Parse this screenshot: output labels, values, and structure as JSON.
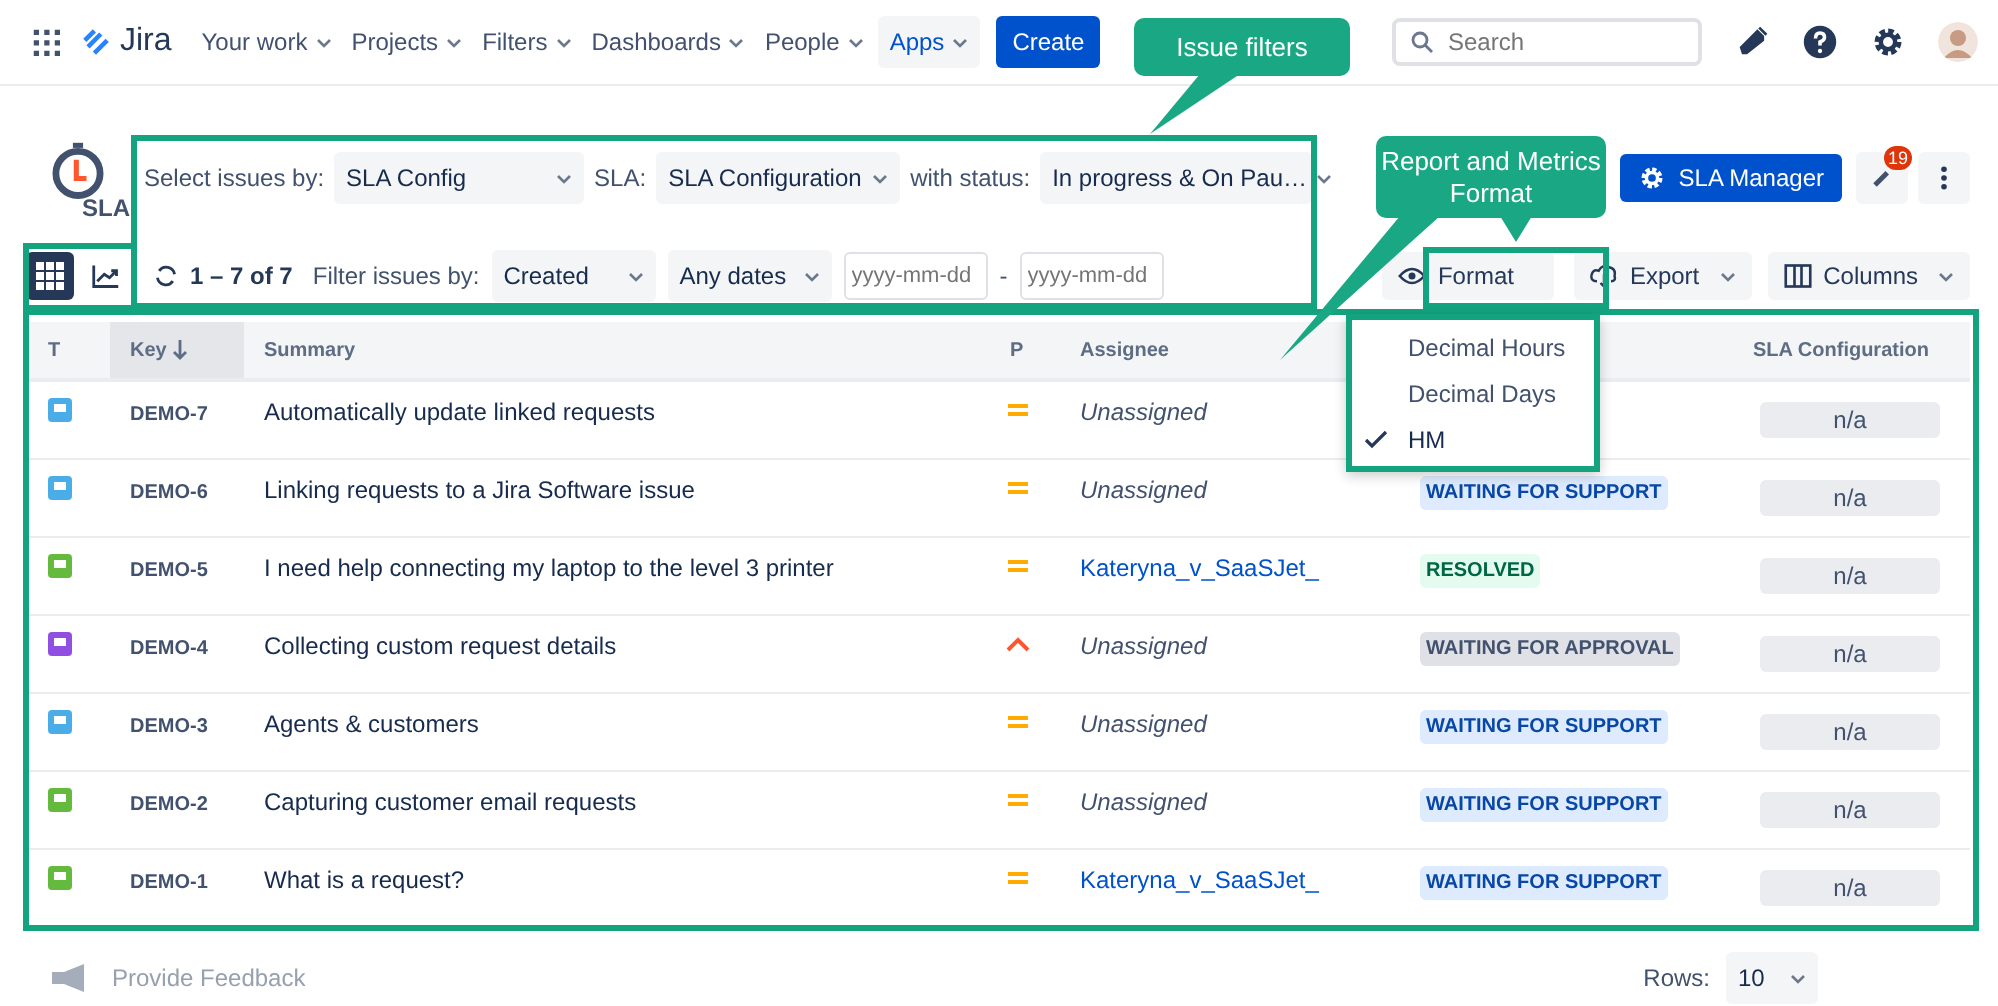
{
  "nav": {
    "product": "Jira",
    "items": [
      {
        "label": "Your work",
        "selected": false
      },
      {
        "label": "Projects",
        "selected": false
      },
      {
        "label": "Filters",
        "selected": false
      },
      {
        "label": "Dashboards",
        "selected": false
      },
      {
        "label": "People",
        "selected": false
      },
      {
        "label": "Apps",
        "selected": true
      }
    ],
    "create": "Create",
    "search": {
      "placeholder": "Search"
    }
  },
  "sla_bar": {
    "logo_text": "SLA",
    "select_label": "Select issues by:",
    "select_value": "SLA Config",
    "sla_label": "SLA:",
    "sla_value": "SLA Configuration",
    "status_label": "with status:",
    "status_value": "In progress & On Pau…",
    "manager_button": "SLA Manager",
    "notification_count": "19"
  },
  "toolbar": {
    "views": [
      {
        "kind": "table",
        "selected": true
      },
      {
        "kind": "chart",
        "selected": false
      }
    ],
    "count": "1 – 7 of 7",
    "filter_label": "Filter issues by:",
    "filter_value": "Created",
    "date_range": "Any dates",
    "date_from": {
      "placeholder": "yyyy-mm-dd"
    },
    "separator": "-",
    "date_to": {
      "placeholder": "yyyy-mm-dd"
    },
    "format": "Format",
    "export": "Export",
    "columns": "Columns"
  },
  "format_menu": [
    {
      "label": "Decimal Hours",
      "checked": false
    },
    {
      "label": "Decimal Days",
      "checked": false
    },
    {
      "label": "HM",
      "checked": true
    }
  ],
  "table": {
    "columns": [
      {
        "label": "T",
        "sorted": false
      },
      {
        "label": "Key",
        "sorted": true
      },
      {
        "label": "Summary",
        "sorted": false
      },
      {
        "label": "P",
        "sorted": false
      },
      {
        "label": "Assignee",
        "sorted": false
      },
      {
        "label": "SLA Configuration",
        "sorted": false
      }
    ],
    "rows": [
      {
        "type": {
          "kind": "service"
        },
        "key": "DEMO-7",
        "summary": "Automatically update linked requests",
        "priority": {
          "kind": "medium"
        },
        "assignee": "Unassigned",
        "assigned": false,
        "sla": "n/a"
      },
      {
        "type": {
          "kind": "service"
        },
        "key": "DEMO-6",
        "summary": "Linking requests to a Jira Software issue",
        "priority": {
          "kind": "medium"
        },
        "assignee": "Unassigned",
        "assigned": false,
        "status": {
          "text": "WAITING FOR SUPPORT",
          "kind": "progress"
        },
        "sla": "n/a"
      },
      {
        "type": {
          "kind": "chat"
        },
        "key": "DEMO-5",
        "summary": "I need help connecting my laptop to the level 3 printer",
        "priority": {
          "kind": "medium"
        },
        "assignee": "Kateryna_v_SaaSJet_",
        "assigned": true,
        "status": {
          "text": "RESOLVED",
          "kind": "done"
        },
        "sla": "n/a"
      },
      {
        "type": {
          "kind": "form"
        },
        "key": "DEMO-4",
        "summary": "Collecting custom request details",
        "priority": {
          "kind": "high"
        },
        "assignee": "Unassigned",
        "assigned": false,
        "status": {
          "text": "WAITING FOR APPROVAL",
          "kind": "todo"
        },
        "sla": "n/a"
      },
      {
        "type": {
          "kind": "service"
        },
        "key": "DEMO-3",
        "summary": "Agents & customers",
        "priority": {
          "kind": "medium"
        },
        "assignee": "Unassigned",
        "assigned": false,
        "status": {
          "text": "WAITING FOR SUPPORT",
          "kind": "progress"
        },
        "sla": "n/a"
      },
      {
        "type": {
          "kind": "chat"
        },
        "key": "DEMO-2",
        "summary": "Capturing customer email requests",
        "priority": {
          "kind": "medium"
        },
        "assignee": "Unassigned",
        "assigned": false,
        "status": {
          "text": "WAITING FOR SUPPORT",
          "kind": "progress"
        },
        "sla": "n/a"
      },
      {
        "type": {
          "kind": "chat"
        },
        "key": "DEMO-1",
        "summary": "What is a request?",
        "priority": {
          "kind": "medium"
        },
        "assignee": "Kateryna_v_SaaSJet_",
        "assigned": true,
        "status": {
          "text": "WAITING FOR SUPPORT",
          "kind": "progress"
        },
        "sla": "n/a"
      }
    ]
  },
  "footer": {
    "feedback": "Provide Feedback",
    "rows_label": "Rows:",
    "rows_value": "10"
  },
  "callouts": [
    {
      "text": "Issue filters"
    },
    {
      "text": "Report and Metrics Format"
    }
  ]
}
